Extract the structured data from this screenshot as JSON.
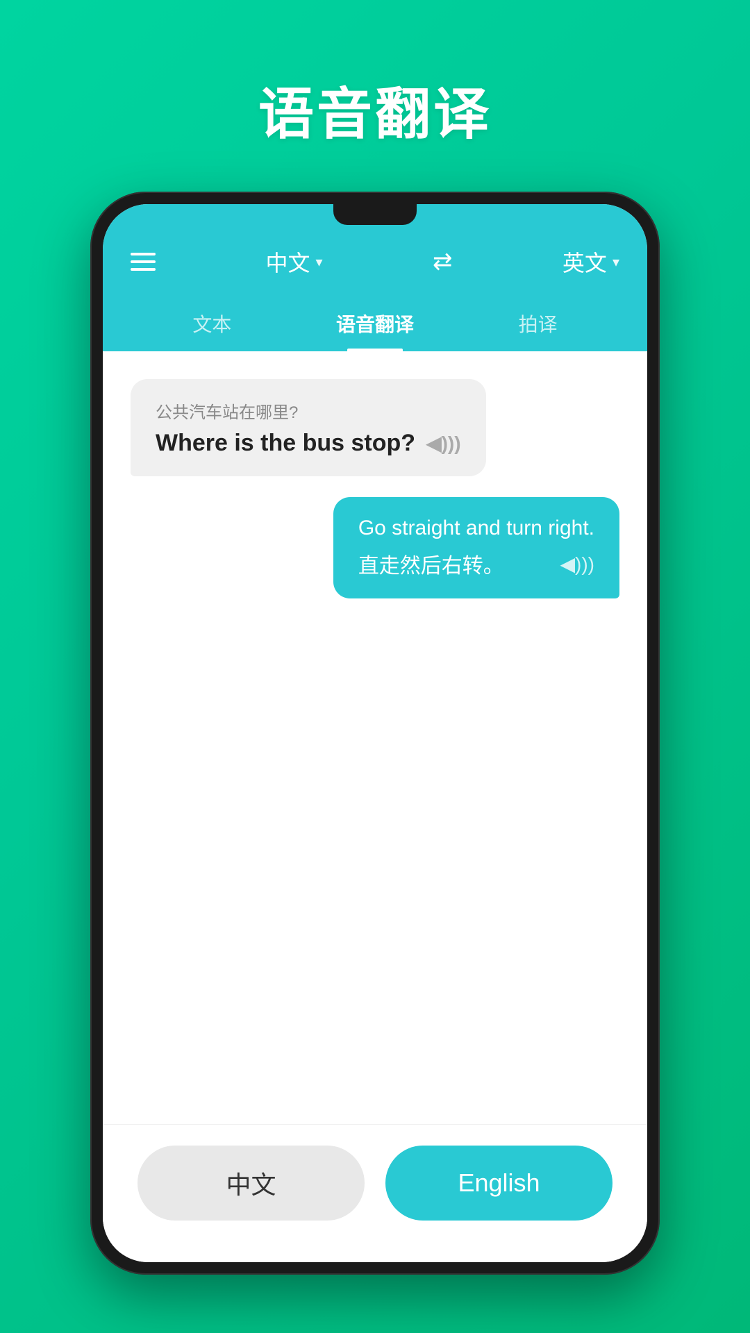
{
  "page": {
    "title": "语音翻译",
    "background_gradient_start": "#00d4a0",
    "background_gradient_end": "#00b878"
  },
  "header": {
    "menu_label": "menu",
    "source_lang": "中文",
    "source_lang_dropdown": "▾",
    "swap_icon": "⇄",
    "target_lang": "英文",
    "target_lang_dropdown": "▾",
    "tabs": [
      {
        "id": "text",
        "label": "文本",
        "active": false
      },
      {
        "id": "voice",
        "label": "语音翻译",
        "active": true
      },
      {
        "id": "photo",
        "label": "拍译",
        "active": false
      }
    ]
  },
  "chat": {
    "messages": [
      {
        "id": "msg1",
        "direction": "left",
        "sub_text": "公共汽车站在哪里?",
        "main_text": "Where is the bus stop?",
        "sound_icon": "◀)))"
      },
      {
        "id": "msg2",
        "direction": "right",
        "main_text": "Go straight and turn right.",
        "sub_text": "直走然后右转。",
        "sound_icon": "◀)))"
      }
    ]
  },
  "bottom_bar": {
    "chinese_btn_label": "中文",
    "english_btn_label": "English"
  }
}
